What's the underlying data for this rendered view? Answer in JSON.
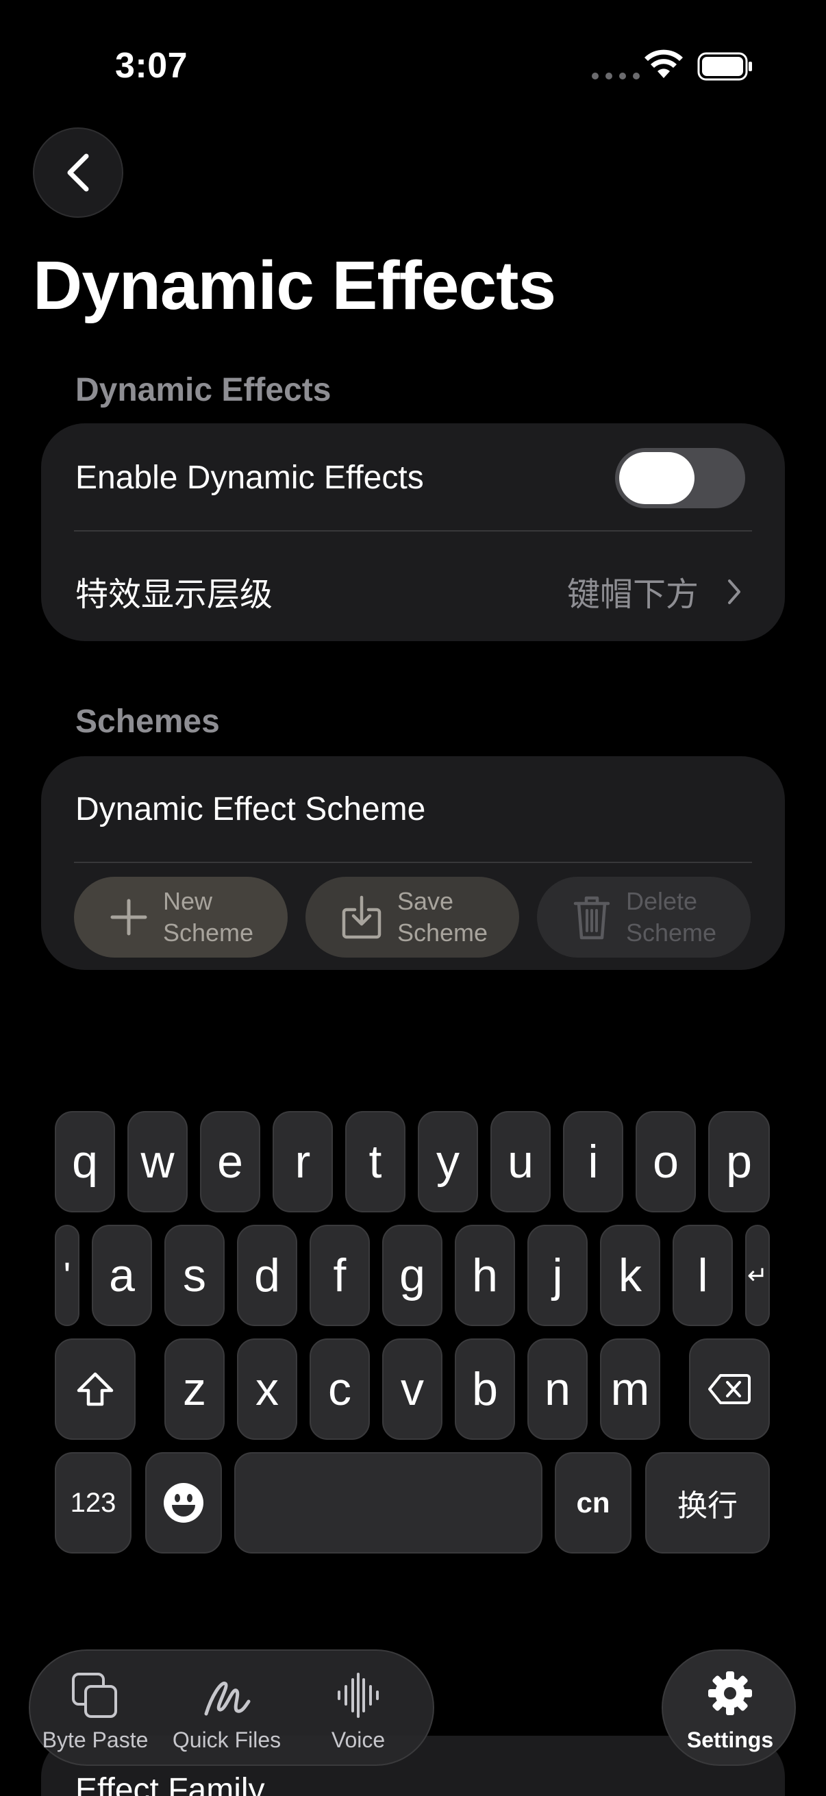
{
  "status": {
    "time": "3:07"
  },
  "page": {
    "title": "Dynamic Effects"
  },
  "section_effects": {
    "label": "Dynamic Effects",
    "enable_label": "Enable Dynamic Effects",
    "enable_on": true,
    "layer_label": "特效显示层级",
    "layer_value": "键帽下方"
  },
  "section_schemes": {
    "label": "Schemes",
    "scheme_name": "Dynamic Effect Scheme",
    "new_label": "New\nScheme",
    "save_label": "Save\nScheme",
    "delete_label": "Delete\nScheme"
  },
  "keyboard": {
    "row1": [
      "q",
      "w",
      "e",
      "r",
      "t",
      "y",
      "u",
      "i",
      "o",
      "p"
    ],
    "row2": [
      "a",
      "s",
      "d",
      "f",
      "g",
      "h",
      "j",
      "k",
      "l"
    ],
    "row3": [
      "z",
      "x",
      "c",
      "v",
      "b",
      "n",
      "m"
    ],
    "apostrophe": "'",
    "return_glyph": "↵",
    "num_label": "123",
    "lang_label": "cn",
    "newline_label": "换行"
  },
  "tabs": {
    "byte_paste": "Byte Paste",
    "quick_files": "Quick Files",
    "voice": "Voice",
    "settings": "Settings"
  },
  "behind": {
    "effect_family": "Effect Family"
  },
  "colors": {
    "accent_new": "#45423d",
    "accent_save": "#3c3a37",
    "accent_delete": "#2c2c2e"
  },
  "icons": {
    "back": "chevron-left-icon",
    "new": "plus-icon",
    "save": "download-icon",
    "delete": "trash-icon",
    "emoji": "emoji-icon",
    "shift": "shift-icon",
    "backspace": "backspace-icon",
    "settings": "gear-icon"
  }
}
